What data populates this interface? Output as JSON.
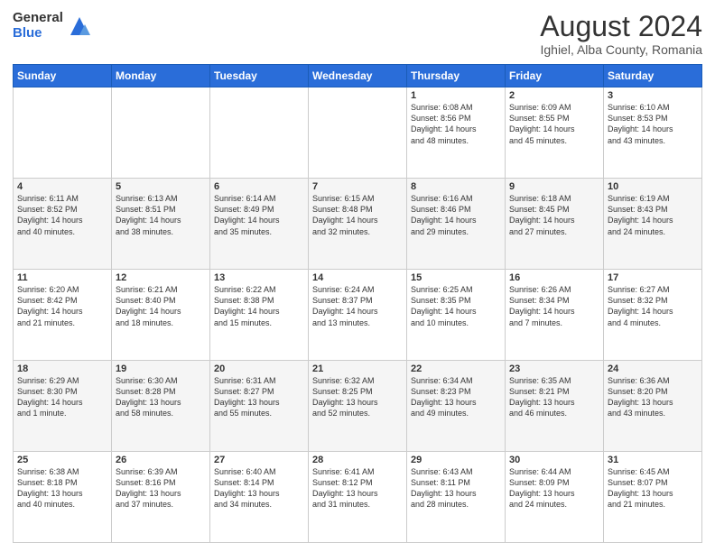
{
  "logo": {
    "general": "General",
    "blue": "Blue"
  },
  "title": "August 2024",
  "subtitle": "Ighiel, Alba County, Romania",
  "days_of_week": [
    "Sunday",
    "Monday",
    "Tuesday",
    "Wednesday",
    "Thursday",
    "Friday",
    "Saturday"
  ],
  "weeks": [
    [
      {
        "day": "",
        "info": ""
      },
      {
        "day": "",
        "info": ""
      },
      {
        "day": "",
        "info": ""
      },
      {
        "day": "",
        "info": ""
      },
      {
        "day": "1",
        "info": "Sunrise: 6:08 AM\nSunset: 8:56 PM\nDaylight: 14 hours\nand 48 minutes."
      },
      {
        "day": "2",
        "info": "Sunrise: 6:09 AM\nSunset: 8:55 PM\nDaylight: 14 hours\nand 45 minutes."
      },
      {
        "day": "3",
        "info": "Sunrise: 6:10 AM\nSunset: 8:53 PM\nDaylight: 14 hours\nand 43 minutes."
      }
    ],
    [
      {
        "day": "4",
        "info": "Sunrise: 6:11 AM\nSunset: 8:52 PM\nDaylight: 14 hours\nand 40 minutes."
      },
      {
        "day": "5",
        "info": "Sunrise: 6:13 AM\nSunset: 8:51 PM\nDaylight: 14 hours\nand 38 minutes."
      },
      {
        "day": "6",
        "info": "Sunrise: 6:14 AM\nSunset: 8:49 PM\nDaylight: 14 hours\nand 35 minutes."
      },
      {
        "day": "7",
        "info": "Sunrise: 6:15 AM\nSunset: 8:48 PM\nDaylight: 14 hours\nand 32 minutes."
      },
      {
        "day": "8",
        "info": "Sunrise: 6:16 AM\nSunset: 8:46 PM\nDaylight: 14 hours\nand 29 minutes."
      },
      {
        "day": "9",
        "info": "Sunrise: 6:18 AM\nSunset: 8:45 PM\nDaylight: 14 hours\nand 27 minutes."
      },
      {
        "day": "10",
        "info": "Sunrise: 6:19 AM\nSunset: 8:43 PM\nDaylight: 14 hours\nand 24 minutes."
      }
    ],
    [
      {
        "day": "11",
        "info": "Sunrise: 6:20 AM\nSunset: 8:42 PM\nDaylight: 14 hours\nand 21 minutes."
      },
      {
        "day": "12",
        "info": "Sunrise: 6:21 AM\nSunset: 8:40 PM\nDaylight: 14 hours\nand 18 minutes."
      },
      {
        "day": "13",
        "info": "Sunrise: 6:22 AM\nSunset: 8:38 PM\nDaylight: 14 hours\nand 15 minutes."
      },
      {
        "day": "14",
        "info": "Sunrise: 6:24 AM\nSunset: 8:37 PM\nDaylight: 14 hours\nand 13 minutes."
      },
      {
        "day": "15",
        "info": "Sunrise: 6:25 AM\nSunset: 8:35 PM\nDaylight: 14 hours\nand 10 minutes."
      },
      {
        "day": "16",
        "info": "Sunrise: 6:26 AM\nSunset: 8:34 PM\nDaylight: 14 hours\nand 7 minutes."
      },
      {
        "day": "17",
        "info": "Sunrise: 6:27 AM\nSunset: 8:32 PM\nDaylight: 14 hours\nand 4 minutes."
      }
    ],
    [
      {
        "day": "18",
        "info": "Sunrise: 6:29 AM\nSunset: 8:30 PM\nDaylight: 14 hours\nand 1 minute."
      },
      {
        "day": "19",
        "info": "Sunrise: 6:30 AM\nSunset: 8:28 PM\nDaylight: 13 hours\nand 58 minutes."
      },
      {
        "day": "20",
        "info": "Sunrise: 6:31 AM\nSunset: 8:27 PM\nDaylight: 13 hours\nand 55 minutes."
      },
      {
        "day": "21",
        "info": "Sunrise: 6:32 AM\nSunset: 8:25 PM\nDaylight: 13 hours\nand 52 minutes."
      },
      {
        "day": "22",
        "info": "Sunrise: 6:34 AM\nSunset: 8:23 PM\nDaylight: 13 hours\nand 49 minutes."
      },
      {
        "day": "23",
        "info": "Sunrise: 6:35 AM\nSunset: 8:21 PM\nDaylight: 13 hours\nand 46 minutes."
      },
      {
        "day": "24",
        "info": "Sunrise: 6:36 AM\nSunset: 8:20 PM\nDaylight: 13 hours\nand 43 minutes."
      }
    ],
    [
      {
        "day": "25",
        "info": "Sunrise: 6:38 AM\nSunset: 8:18 PM\nDaylight: 13 hours\nand 40 minutes."
      },
      {
        "day": "26",
        "info": "Sunrise: 6:39 AM\nSunset: 8:16 PM\nDaylight: 13 hours\nand 37 minutes."
      },
      {
        "day": "27",
        "info": "Sunrise: 6:40 AM\nSunset: 8:14 PM\nDaylight: 13 hours\nand 34 minutes."
      },
      {
        "day": "28",
        "info": "Sunrise: 6:41 AM\nSunset: 8:12 PM\nDaylight: 13 hours\nand 31 minutes."
      },
      {
        "day": "29",
        "info": "Sunrise: 6:43 AM\nSunset: 8:11 PM\nDaylight: 13 hours\nand 28 minutes."
      },
      {
        "day": "30",
        "info": "Sunrise: 6:44 AM\nSunset: 8:09 PM\nDaylight: 13 hours\nand 24 minutes."
      },
      {
        "day": "31",
        "info": "Sunrise: 6:45 AM\nSunset: 8:07 PM\nDaylight: 13 hours\nand 21 minutes."
      }
    ]
  ]
}
